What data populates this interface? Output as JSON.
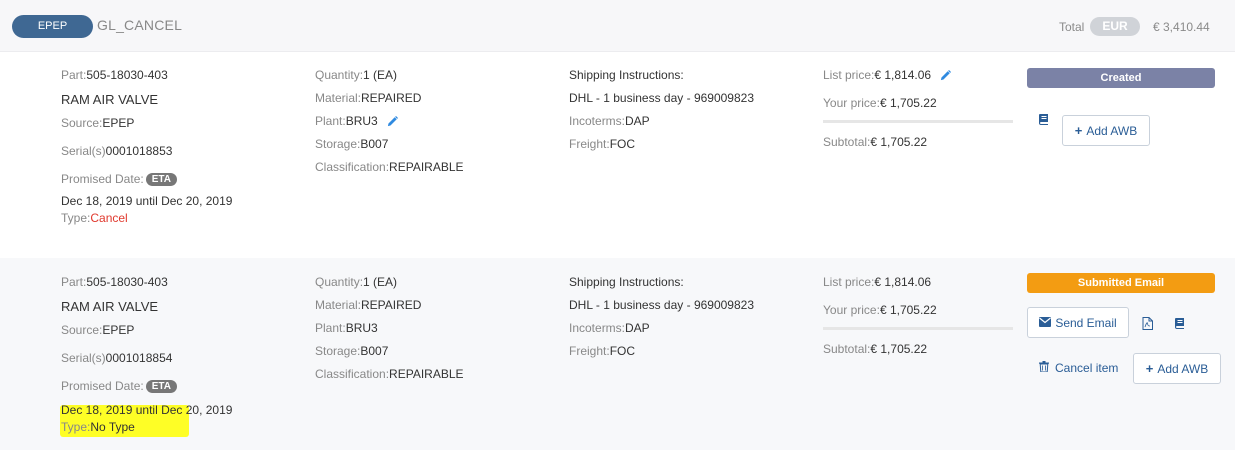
{
  "header": {
    "code": "EPEP",
    "title": "GL_CANCEL",
    "total_label": "Total",
    "currency": "EUR",
    "total_value": "€ 3,410.44"
  },
  "items": [
    {
      "part_label": "Part:",
      "part": "505-18030-403",
      "description": "RAM AIR VALVE",
      "source_label": "Source:",
      "source": "EPEP",
      "serial_label": "Serial(s)",
      "serial": "0001018853",
      "promised_label": "Promised Date:",
      "eta": "ETA",
      "dates": "Dec 18, 2019 until Dec 20, 2019",
      "type_label": "Type:",
      "type": "Cancel",
      "quantity_label": "Quantity:",
      "quantity": "1 (EA)",
      "material_label": "Material:",
      "material": "REPAIRED",
      "plant_label": "Plant:",
      "plant": "BRU3",
      "storage_label": "Storage:",
      "storage": "B007",
      "classification_label": "Classification:",
      "classification": "REPAIRABLE",
      "shipping_label": "Shipping Instructions:",
      "shipping": "DHL - 1 business day - 969009823",
      "incoterms_label": "Incoterms:",
      "incoterms": "DAP",
      "freight_label": "Freight:",
      "freight": "FOC",
      "list_price_label": "List price:",
      "list_price": "€ 1,814.06",
      "your_price_label": "Your price:",
      "your_price": "€ 1,705.22",
      "subtotal_label": "Subtotal:",
      "subtotal": "€ 1,705.22",
      "status": "Created",
      "add_awb": "Add AWB"
    },
    {
      "part_label": "Part:",
      "part": "505-18030-403",
      "description": "RAM AIR VALVE",
      "source_label": "Source:",
      "source": "EPEP",
      "serial_label": "Serial(s)",
      "serial": "0001018854",
      "promised_label": "Promised Date:",
      "eta": "ETA",
      "dates": "Dec 18, 2019 until Dec 20, 2019",
      "type_label": "Type:",
      "type": "No Type",
      "quantity_label": "Quantity:",
      "quantity": "1 (EA)",
      "material_label": "Material:",
      "material": "REPAIRED",
      "plant_label": "Plant:",
      "plant": "BRU3",
      "storage_label": "Storage:",
      "storage": "B007",
      "classification_label": "Classification:",
      "classification": "REPAIRABLE",
      "shipping_label": "Shipping Instructions:",
      "shipping": "DHL - 1 business day - 969009823",
      "incoterms_label": "Incoterms:",
      "incoterms": "DAP",
      "freight_label": "Freight:",
      "freight": "FOC",
      "list_price_label": "List price:",
      "list_price": "€ 1,814.06",
      "your_price_label": "Your price:",
      "your_price": "€ 1,705.22",
      "subtotal_label": "Subtotal:",
      "subtotal": "€ 1,705.22",
      "status": "Submitted Email",
      "send_email": "Send Email",
      "cancel_item": "Cancel item",
      "add_awb": "Add AWB"
    }
  ],
  "colors": {
    "code_pill": "#3f6893",
    "status_created": "#7b82a6",
    "status_submitted": "#f39c12",
    "type_cancel": "#e0392e",
    "highlight": "#ffff00",
    "link": "#2a5d96"
  },
  "icons": {
    "edit": "pencil-icon",
    "book": "book-icon",
    "add": "plus-icon",
    "email": "envelope-icon",
    "pdf": "pdf-file-icon",
    "delete": "trash-icon"
  }
}
